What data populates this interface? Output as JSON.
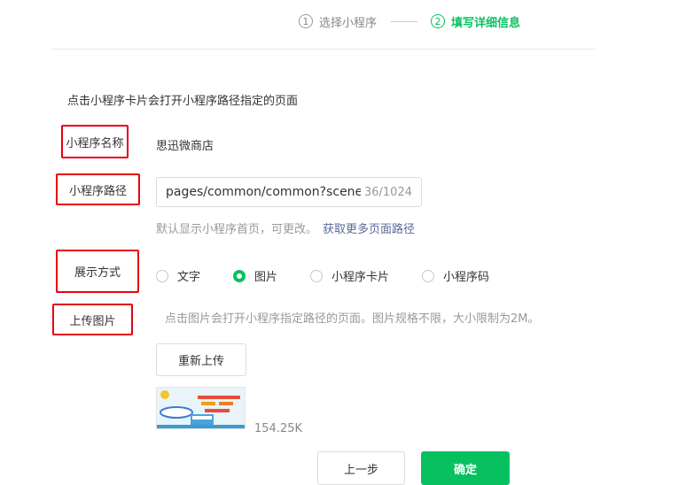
{
  "stepper": {
    "step1": {
      "number": "1",
      "label": "选择小程序"
    },
    "step2": {
      "number": "2",
      "label": "填写详细信息"
    }
  },
  "form": {
    "hint": "点击小程序卡片会打开小程序路径指定的页面",
    "name": {
      "label": "小程序名称",
      "value": "思迅微商店"
    },
    "path": {
      "label": "小程序路径",
      "value": "pages/common/common?scene",
      "counter": "36/1024",
      "sub_hint": "默认显示小程序首页，可更改。",
      "more_link": "获取更多页面路径"
    },
    "display": {
      "label": "展示方式",
      "options": [
        {
          "label": "文字",
          "checked": false
        },
        {
          "label": "图片",
          "checked": true
        },
        {
          "label": "小程序卡片",
          "checked": false
        },
        {
          "label": "小程序码",
          "checked": false
        }
      ]
    },
    "upload": {
      "label": "上传图片",
      "hint": "点击图片会打开小程序指定路径的页面。图片规格不限，大小限制为2M。",
      "reupload_label": "重新上传",
      "file_size": "154.25K"
    }
  },
  "footer": {
    "prev_label": "上一步",
    "confirm_label": "确定"
  },
  "colors": {
    "accent": "#07c160",
    "link": "#576b95",
    "highlight_box": "#e60012"
  }
}
